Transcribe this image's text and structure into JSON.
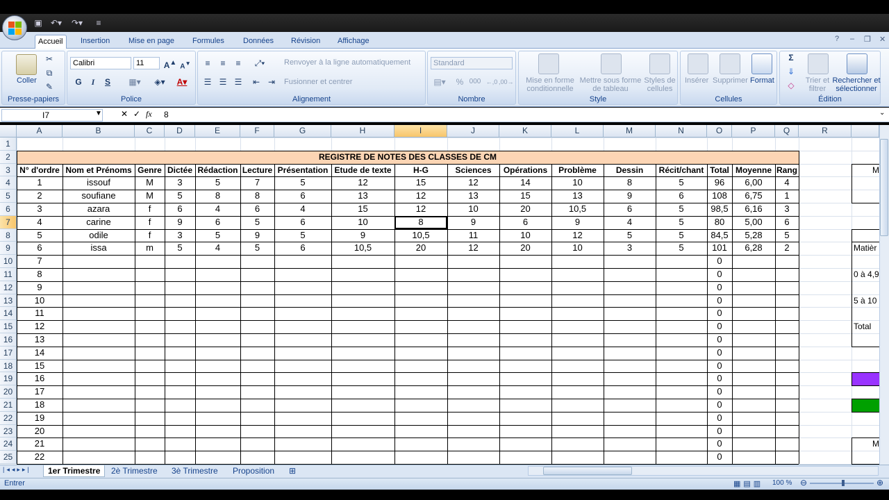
{
  "ribbon": {
    "tabs": [
      "Accueil",
      "Insertion",
      "Mise en page",
      "Formules",
      "Données",
      "Révision",
      "Affichage"
    ],
    "active_tab": "Accueil",
    "clipboard": {
      "paste_label": "Coller",
      "group_label": "Presse-papiers"
    },
    "font": {
      "name": "Calibri",
      "size": "11",
      "bold": "G",
      "italic": "I",
      "underline": "S",
      "group_label": "Police"
    },
    "alignment": {
      "wrap_label": "Renvoyer à la ligne automatiquement",
      "merge_label": "Fusionner et centrer",
      "group_label": "Alignement"
    },
    "number": {
      "format": "Standard",
      "percent": "%",
      "thousands": "000",
      "group_label": "Nombre"
    },
    "style": {
      "conditional_label": "Mise en forme conditionnelle",
      "table_label": "Mettre sous forme de tableau",
      "cell_styles_label": "Styles de cellules",
      "group_label": "Style"
    },
    "cells": {
      "insert_label": "Insérer",
      "delete_label": "Supprimer",
      "format_label": "Format",
      "group_label": "Cellules"
    },
    "editing": {
      "sort_label": "Trier et filtrer",
      "find_label": "Rechercher et sélectionner",
      "group_label": "Édition"
    }
  },
  "formula_bar": {
    "name_box": "I7",
    "cancel": "✕",
    "enter": "✓",
    "fx": "fx",
    "value": "8"
  },
  "grid": {
    "columns": [
      "A",
      "B",
      "C",
      "D",
      "E",
      "F",
      "G",
      "H",
      "I",
      "J",
      "K",
      "L",
      "M",
      "N",
      "O",
      "P",
      "Q",
      "R"
    ],
    "selected_column": "I",
    "selected_row": "7",
    "rows": [
      "1",
      "2",
      "3",
      "4",
      "5",
      "6",
      "7",
      "8",
      "9",
      "10",
      "11",
      "12",
      "13",
      "14",
      "15",
      "16",
      "17",
      "18",
      "19",
      "20",
      "21",
      "22",
      "23",
      "24",
      "25"
    ],
    "title": "REGISTRE DE NOTES DES CLASSES DE CM",
    "headers": [
      "N° d'ordre",
      "Nom et Prénoms",
      "Genre",
      "Dictée",
      "Rédaction",
      "Lecture",
      "Présentation",
      "Etude de texte",
      "H-G",
      "Sciences",
      "Opérations",
      "Problème",
      "Dessin",
      "Récit/chant",
      "Total",
      "Moyenne",
      "Rang"
    ],
    "students": [
      [
        "1",
        "issouf",
        "M",
        "3",
        "5",
        "7",
        "5",
        "12",
        "15",
        "12",
        "14",
        "10",
        "8",
        "5",
        "96",
        "6,00",
        "4"
      ],
      [
        "2",
        "soufiane",
        "M",
        "5",
        "8",
        "8",
        "6",
        "13",
        "12",
        "13",
        "15",
        "13",
        "9",
        "6",
        "108",
        "6,75",
        "1"
      ],
      [
        "3",
        "azara",
        "f",
        "6",
        "4",
        "6",
        "4",
        "15",
        "12",
        "10",
        "20",
        "10,5",
        "6",
        "5",
        "98,5",
        "6,16",
        "3"
      ],
      [
        "4",
        "carine",
        "f",
        "9",
        "6",
        "5",
        "6",
        "10",
        "8",
        "9",
        "6",
        "9",
        "4",
        "5",
        "80",
        "5,00",
        "6"
      ],
      [
        "5",
        "odile",
        "f",
        "3",
        "5",
        "9",
        "5",
        "9",
        "10,5",
        "11",
        "10",
        "12",
        "5",
        "5",
        "84,5",
        "5,28",
        "5"
      ],
      [
        "6",
        "issa",
        "m",
        "5",
        "4",
        "5",
        "6",
        "10,5",
        "20",
        "12",
        "20",
        "10",
        "3",
        "5",
        "101",
        "6,28",
        "2"
      ]
    ],
    "empty_rows": [
      [
        "7",
        "0"
      ],
      [
        "8",
        "0"
      ],
      [
        "9",
        "0"
      ],
      [
        "10",
        "0"
      ],
      [
        "11",
        "0"
      ],
      [
        "12",
        "0"
      ],
      [
        "13",
        "0"
      ],
      [
        "14",
        "0"
      ],
      [
        "15",
        "0"
      ],
      [
        "16",
        "0"
      ],
      [
        "17",
        "0"
      ],
      [
        "18",
        "0"
      ],
      [
        "19",
        "0"
      ],
      [
        "20",
        "0"
      ],
      [
        "21",
        "0"
      ],
      [
        "22",
        "0"
      ]
    ],
    "side_panel": {
      "row3": "M",
      "r9": "Matièr",
      "r11": "0 à 4,9",
      "r13": "5 à 10",
      "r15": "Total",
      "r24": "M"
    },
    "colors": {
      "title_fill": "#fcd5b4",
      "purple": "#9933ff",
      "green": "#00a000"
    }
  },
  "sheets": [
    "1er Trimestre",
    "2è Trimestre",
    "3è Trimestre",
    "Proposition"
  ],
  "active_sheet": "1er Trimestre",
  "status": {
    "mode": "Entrer",
    "zoom": "100 %"
  }
}
